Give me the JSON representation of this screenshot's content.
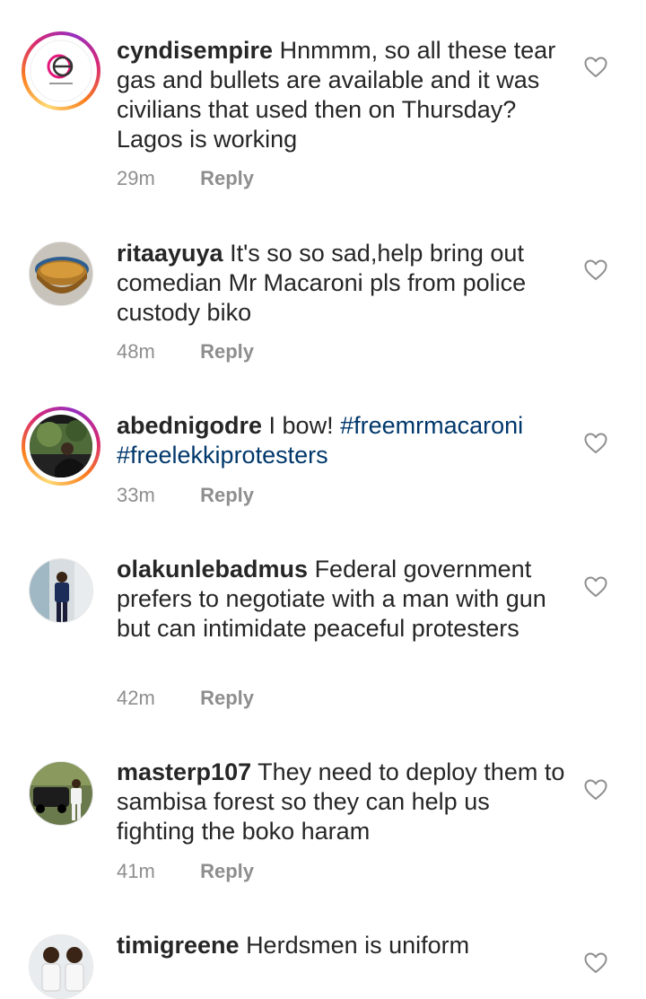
{
  "comments": [
    {
      "username": "cyndisempire",
      "text": "Hnmmm, so all these tear gas and bullets are available  and it was civilians that used then on Thursday? Lagos is working",
      "time": "29m",
      "reply_label": "Reply",
      "avatar": "e-logo-avatar",
      "has_story_ring": true
    },
    {
      "username": "ritaayuya",
      "text": "It's so so sad,help bring out comedian Mr Macaroni pls from police custody biko",
      "time": "48m",
      "reply_label": "Reply",
      "avatar": "bowl-photo-avatar",
      "has_story_ring": false
    },
    {
      "username": "abednigodre",
      "text": "I bow!",
      "hashtags": [
        "#freemrmacaroni",
        "#freelekkiprotesters"
      ],
      "time": "33m",
      "reply_label": "Reply",
      "avatar": "person-outdoor-avatar",
      "has_story_ring": true
    },
    {
      "username": "olakunlebadmus",
      "text": "Federal government prefers to negotiate with a man with gun but can intimidate peaceful protesters",
      "time": "42m",
      "reply_label": "Reply",
      "avatar": "person-standing-avatar",
      "has_story_ring": false
    },
    {
      "username": "masterp107",
      "text": "They need to deploy them to sambisa forest so they can help us fighting the boko haram",
      "time": "41m",
      "reply_label": "Reply",
      "avatar": "person-car-avatar",
      "has_story_ring": false
    },
    {
      "username": "timigreene",
      "text": "Herdsmen is uniform",
      "avatar": "two-people-avatar",
      "has_story_ring": false
    }
  ],
  "colors": {
    "text": "#262626",
    "meta": "#8e8e8e",
    "hashtag": "#00376b",
    "ring_gradient": [
      "#feda75",
      "#fa7e1e",
      "#d62976",
      "#962fbf"
    ]
  },
  "icons": {
    "like": "heart-outline-icon"
  }
}
